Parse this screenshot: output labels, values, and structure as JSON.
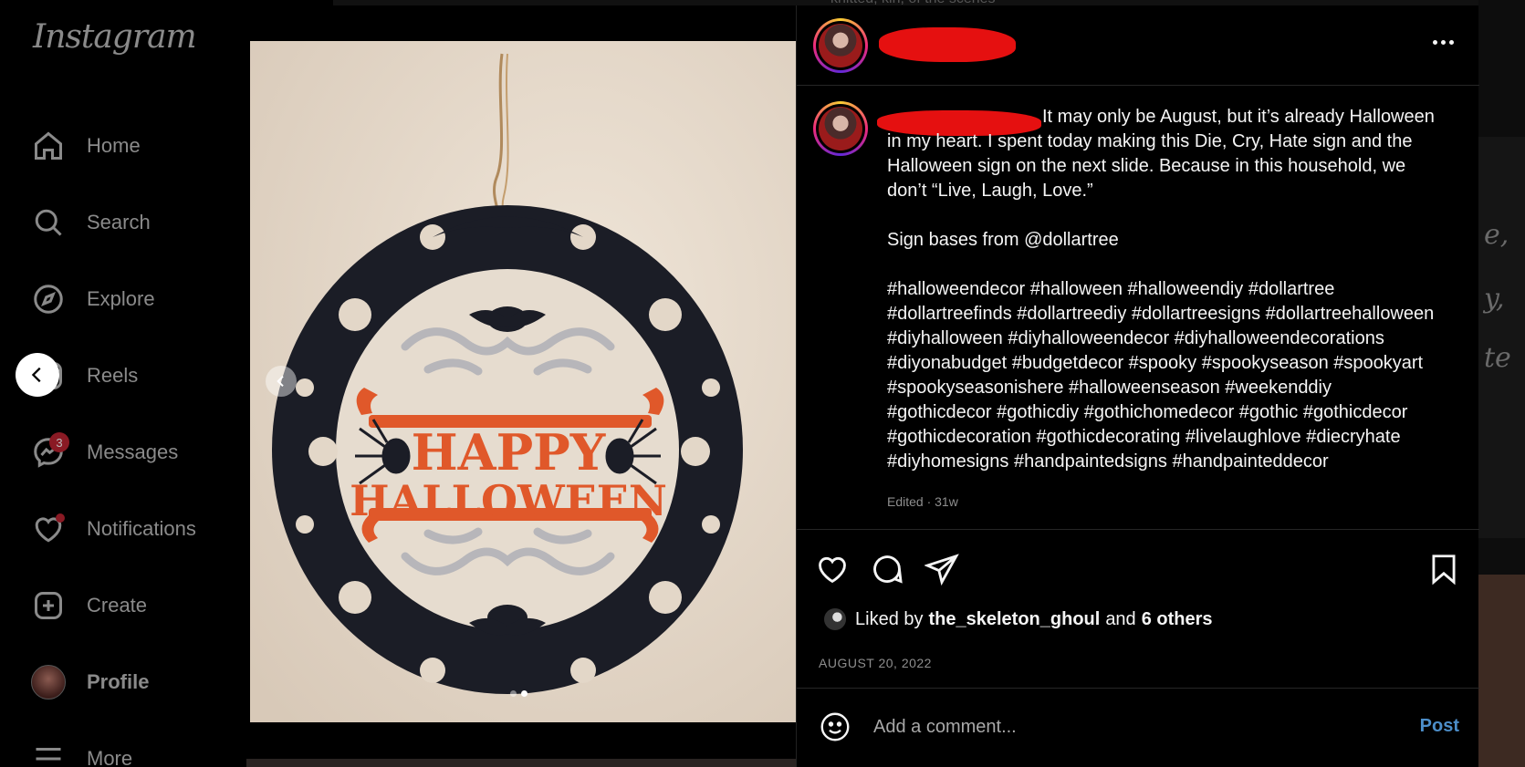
{
  "app": {
    "logo": "Instagram"
  },
  "nav": [
    {
      "label": "Home",
      "icon": "home-icon"
    },
    {
      "label": "Search",
      "icon": "search-icon"
    },
    {
      "label": "Explore",
      "icon": "compass-icon"
    },
    {
      "label": "Reels",
      "icon": "reels-icon"
    },
    {
      "label": "Messages",
      "icon": "messenger-icon",
      "badge": "3"
    },
    {
      "label": "Notifications",
      "icon": "heart-icon"
    },
    {
      "label": "Create",
      "icon": "plus-square-icon"
    },
    {
      "label": "Profile",
      "icon": "avatar"
    },
    {
      "label": "More",
      "icon": "menu-icon"
    }
  ],
  "image": {
    "sign_line1": "HAPPY",
    "sign_line2": "HALLOWEEN",
    "slide_count": 2,
    "active_slide": 2
  },
  "post": {
    "caption_first": "It may only be August, but it’s already Halloween in my heart. I spent today making this Die, Cry, Hate sign and the Halloween sign on the next slide. Because in this household, we don’t “Live, Laugh, Love.”",
    "caption_second": "Sign bases from @dollartree",
    "hashtags": "#halloweendecor #halloween #halloweendiy #dollartree #dollartreefinds #dollartreediy #dollartreesigns #dollartreehalloween #diyhalloween #diyhalloweendecor #diyhalloweendecorations #diyonabudget #budgetdecor #spooky #spookyseason #spookyart #spookyseasonishere #halloweenseason #weekenddiy #gothicdecor #gothicdiy #gothichomedecor #gothic #gothicdecor #gothicdecoration #gothicdecorating #livelaughlove #diecryhate #diyhomesigns #handpaintedsigns #handpainteddecor",
    "edited": "Edited · 31w",
    "liked_prefix": "Liked by",
    "liked_user": "the_skeleton_ghoul",
    "liked_and": "and",
    "liked_others": "6 others",
    "date": "AUGUST 20, 2022"
  },
  "comment": {
    "placeholder": "Add a comment...",
    "post_label": "Post"
  },
  "background": {
    "feed_top_text": "knitted, kin, of the scenes",
    "right_letters": [
      "e,",
      "y,",
      "te"
    ]
  },
  "colors": {
    "accent": "#4c8ec9",
    "redaction": "#e51010",
    "sign_orange": "#e0582a",
    "frame": "#1b1d26",
    "wall": "#e9ded1"
  }
}
